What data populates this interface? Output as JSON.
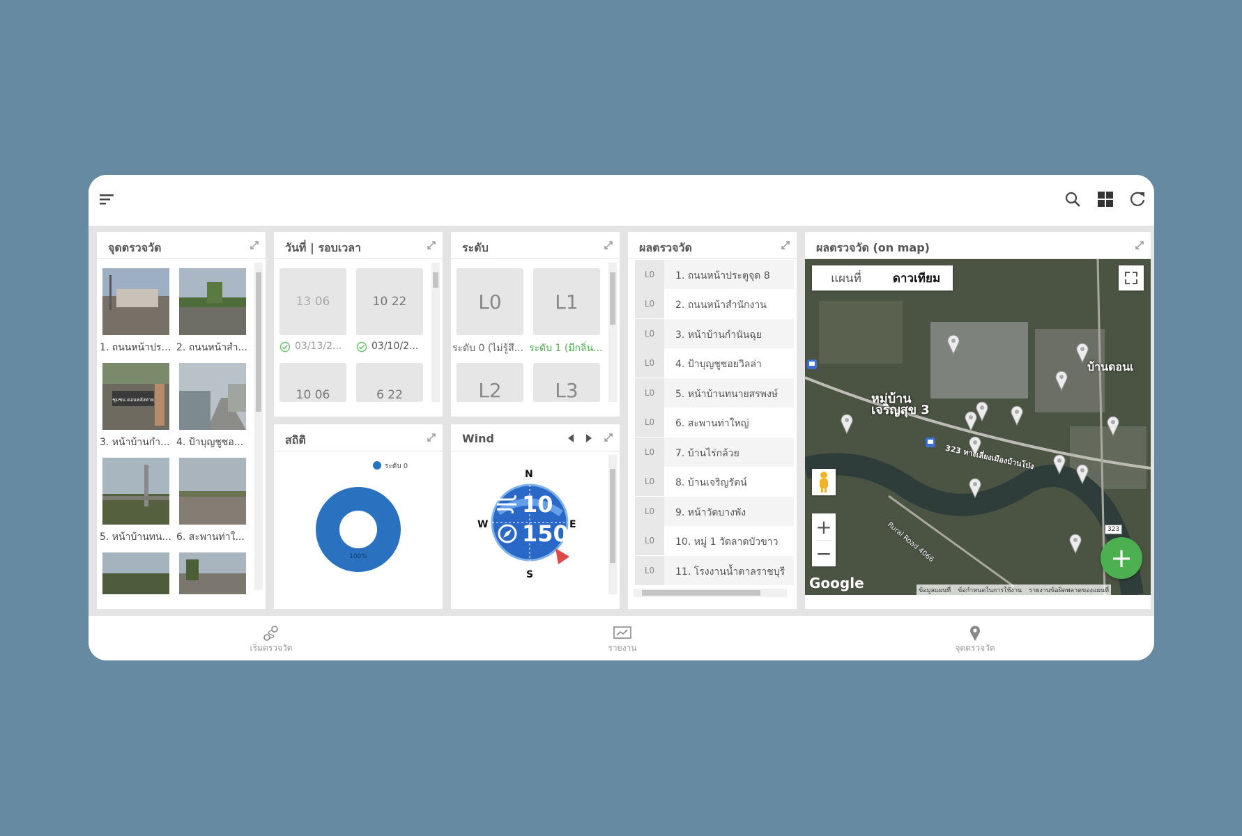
{
  "colors": {
    "page_bg": "#668aa2",
    "accent_blue": "#2a72c0",
    "green_fab": "#4caf50",
    "ok_green": "#6cc270"
  },
  "panels": {
    "points": {
      "title": "จุดตรวจวัด",
      "captions": [
        "1. ถนนหน้าประ...",
        "2. ถนนหน้าสำ...",
        "3. หน้าบ้านกำ...",
        "4. ป้าบุญชูซอ...",
        "5. หน้าบ้านทน...",
        "6. สะพานท่าใ..."
      ],
      "signboard": "ชุมชน ดอนหลังทาย"
    },
    "datetime": {
      "title": "วันที่ | รอบเวลา",
      "tiles": [
        "13 06",
        "10 22",
        "10 06",
        "6 22"
      ],
      "dates": [
        "03/13/2...",
        "03/10/2..."
      ]
    },
    "level": {
      "title": "ระดับ",
      "tiles": [
        "L0",
        "L1",
        "L2",
        "L3"
      ],
      "captions": [
        "ระดับ 0 (ไม่รู้สึ...",
        "ระดับ 1 (มีกลิ่น..."
      ]
    },
    "stats": {
      "title": "สถิติ",
      "legend": "ระดับ 0",
      "percent": "100%"
    },
    "wind": {
      "title": "Wind",
      "speed": "10",
      "direction": "150",
      "n": "N",
      "s": "S",
      "e": "E",
      "w": "W"
    },
    "results": {
      "title": "ผลตรวจวัด",
      "rows": [
        {
          "level": "L0",
          "name": "1. ถนนหน้าประตูจุด 8"
        },
        {
          "level": "L0",
          "name": "2. ถนนหน้าสำนักงาน"
        },
        {
          "level": "L0",
          "name": "3. หน้าบ้านกำนันฉุย"
        },
        {
          "level": "L0",
          "name": "4. ป้าบุญชูซอยวิลล่า"
        },
        {
          "level": "L0",
          "name": "5. หน้าบ้านทนายสรพงษ์"
        },
        {
          "level": "L0",
          "name": "6. สะพานท่าใหญ่"
        },
        {
          "level": "L0",
          "name": "7. บ้านไร่กล้วย"
        },
        {
          "level": "L0",
          "name": "8. บ้านเจริญรัตน์"
        },
        {
          "level": "L0",
          "name": "9. หน้าวัดบางพัง"
        },
        {
          "level": "L0",
          "name": "10. หมู่ 1 วัดลาดบัวขาว"
        },
        {
          "level": "L0",
          "name": "11. โรงงานน้ำตาลราชบุรี"
        }
      ]
    },
    "map": {
      "title": "ผลตรวจวัด (on map)",
      "tab_map": "แผนที่",
      "tab_satellite": "ดาวเทียม",
      "label_village": "หมู่บ้าน เจริญสุข 3",
      "label_donnoi": "บ้านดอนเ",
      "label_road323": "323 ทางเลี่ยงเมืองบ้านโป่ง",
      "label_rural": "Rural Road 4066",
      "route_badge": "323",
      "google": "Google",
      "zoom_in": "+",
      "zoom_out": "−",
      "footer": [
        "ข้อมูลแผนที่",
        "ข้อกำหนดในการใช้งาน",
        "รายงานข้อผิดพลาดของแผนที่"
      ]
    }
  },
  "bottom_nav": [
    {
      "label": "เริ่มตรวจวัด",
      "icon": "route-icon"
    },
    {
      "label": "รายงาน",
      "icon": "report-icon"
    },
    {
      "label": "จุดตรวจวัด",
      "icon": "location-pin-icon"
    }
  ],
  "fab": {
    "label": "+"
  }
}
